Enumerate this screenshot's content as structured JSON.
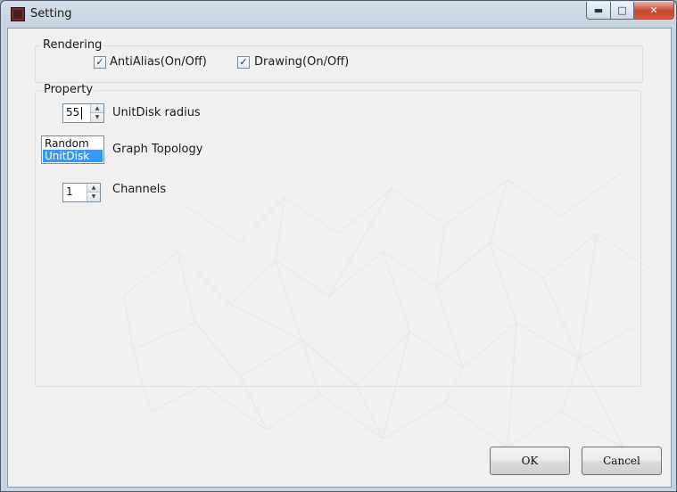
{
  "window": {
    "title": "Setting",
    "icon": "app-icon",
    "controls": {
      "minimize": "▬",
      "maximize": "□",
      "close": "✕"
    }
  },
  "rendering": {
    "group_label": "Rendering",
    "antialias": {
      "label": "AntiAlias(On/Off)",
      "checked": true,
      "mark": "✓"
    },
    "drawing": {
      "label": "Drawing(On/Off)",
      "checked": true,
      "mark": "✓"
    }
  },
  "property": {
    "group_label": "Property",
    "unitdisk_radius": {
      "value": "55",
      "label": "UnitDisk radius"
    },
    "graph_topology": {
      "options": [
        "Random",
        "UnitDisk"
      ],
      "selected_index": 1,
      "label": "Graph Topology"
    },
    "channels": {
      "value": "1",
      "label": "Channels"
    },
    "spin_up": "▲",
    "spin_down": "▼"
  },
  "buttons": {
    "ok": "OK",
    "cancel": "Cancel"
  },
  "colors": {
    "selection": "#3399ff",
    "close_button": "#c5432d"
  }
}
